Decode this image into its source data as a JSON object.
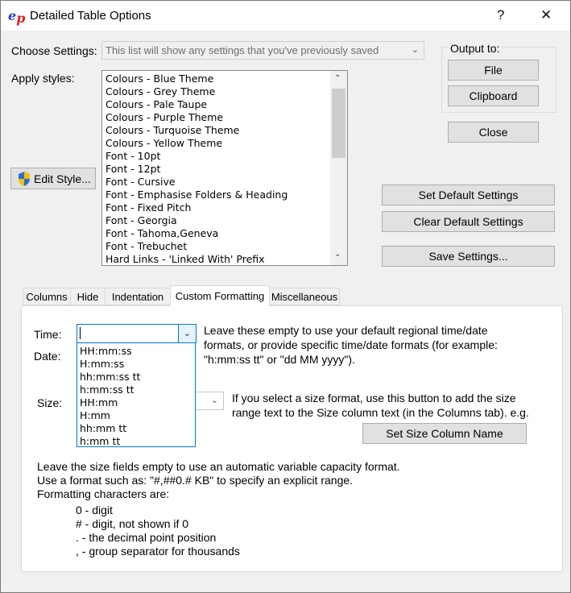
{
  "window": {
    "title": "Detailed Table Options",
    "help_glyph": "?",
    "close_glyph": "✕",
    "logo_e": "e",
    "logo_p": "p"
  },
  "settings": {
    "choose_label": "Choose Settings:",
    "choose_value": "This list will show any settings that you've previously saved",
    "apply_label": "Apply styles:",
    "styles": [
      "Colours - Blue Theme",
      "Colours - Grey Theme",
      "Colours - Pale Taupe",
      "Colours - Purple Theme",
      "Colours - Turquoise Theme",
      "Colours - Yellow Theme",
      "Font - 10pt",
      "Font - 12pt",
      "Font - Cursive",
      "Font - Emphasise Folders & Heading",
      "Font - Fixed Pitch",
      "Font - Georgia",
      "Font - Tahoma,Geneva",
      "Font - Trebuchet",
      "Hard Links - 'Linked With' Prefix"
    ],
    "edit_style": "Edit Style..."
  },
  "output": {
    "label": "Output to:",
    "file": "File",
    "clipboard": "Clipboard"
  },
  "buttons": {
    "close": "Close",
    "set_default": "Set Default Settings",
    "clear_default": "Clear Default Settings",
    "save": "Save Settings..."
  },
  "tabs": [
    "Columns",
    "Hide",
    "Indentation",
    "Custom Formatting",
    "Miscellaneous"
  ],
  "active_tab": "Custom Formatting",
  "custom": {
    "time_label": "Time:",
    "time_value": "",
    "date_label": "Date:",
    "size_label": "Size:",
    "time_help": [
      "Leave these empty to use your default regional time/date",
      "formats, or provide specific time/date formats (for example:",
      "\"h:mm:ss tt\" or \"dd MM yyyy\")."
    ],
    "time_options": [
      "HH:mm:ss",
      "H:mm:ss",
      "hh:mm:ss tt",
      "h:mm:ss tt",
      "HH:mm",
      "H:mm",
      "hh:mm tt",
      "h:mm tt"
    ],
    "size_help": [
      "If you select a size format, use this button to add the size",
      "range text to the Size column text (in the Columns tab). e.g."
    ],
    "set_size_button": "Set Size Column Name",
    "notes": [
      "Leave the size fields empty to use an automatic variable capacity format.",
      "Use a format such as: \"#,##0.# KB\" to specify an explicit range.",
      "Formatting characters are:"
    ],
    "chars": [
      "0 - digit",
      "# - digit, not shown if 0",
      ". - the decimal point position",
      ", - group separator for thousands"
    ]
  }
}
